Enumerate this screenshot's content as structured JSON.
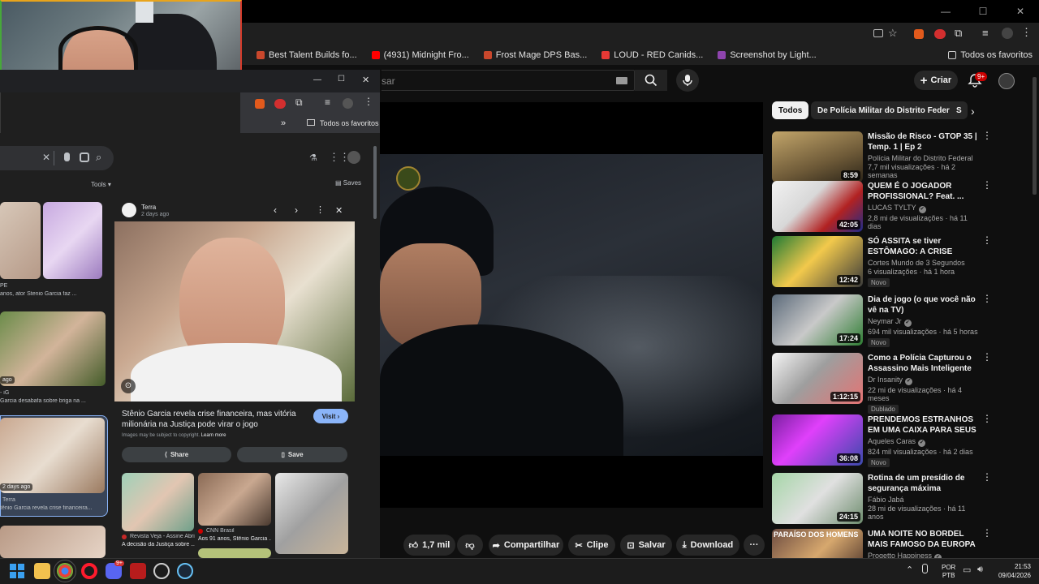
{
  "main_browser": {
    "window_controls": {
      "minimize": "—",
      "maximize": "☐",
      "close": "✕"
    },
    "bookmarks": [
      {
        "label": "Best Talent Builds fo...",
        "color": "#c9472c"
      },
      {
        "label": "(4931) Midnight Fro...",
        "color": "#ff0000"
      },
      {
        "label": "Frost Mage DPS Bas...",
        "color": "#c9472c"
      },
      {
        "label": "LOUD - RED Canids...",
        "color": "#e53935"
      },
      {
        "label": "Screenshot by Light...",
        "color": "#8e44ad"
      }
    ],
    "all_favorites": "Todos os favoritos"
  },
  "youtube": {
    "search_placeholder": "sar",
    "create_label": "Criar",
    "notif_count": "9+",
    "chips": [
      "Todos",
      "De Polícia Militar do Distrito Federal",
      "S"
    ],
    "actions": {
      "likes": "1,7 mil",
      "share": "Compartilhar",
      "clip": "Clipe",
      "save": "Salvar",
      "download": "Download"
    },
    "recommendations": [
      {
        "title": "Missão de Risco - GTOP 35 | Temp. 1 | Ep 2",
        "channel": "Polícia Militar do Distrito Federal",
        "meta": "7,7 mil visualizações · há 2 semanas",
        "duration": "8:59",
        "badge": "",
        "verified": false,
        "thumb": "linear-gradient(160deg,#c2a56a,#6e5a38 60%,#2b2418)"
      },
      {
        "title": "QUEM É O JOGADOR PROFISSIONAL? Feat. ...",
        "channel": "LUCAS TYLTY",
        "meta": "2,8 mi de visualizações · há 11 dias",
        "duration": "42:05",
        "badge": "",
        "verified": true,
        "thumb": "linear-gradient(135deg,#f2f2f2,#d8d8d8 40%,#b22222 70%,#1f2b8a)"
      },
      {
        "title": "SÓ ASSITA se tiver ESTÔMAGO: A CRISE Silenciosa Que ...",
        "channel": "Cortes Mundo de 3 Segundos",
        "meta": "6 visualizações · há 1 hora",
        "duration": "12:42",
        "badge": "Novo",
        "verified": false,
        "thumb": "linear-gradient(135deg,#1e7a34,#f2c94c 45%,#3a3a3a)"
      },
      {
        "title": "Dia de jogo (o que você não vê na TV)",
        "channel": "Neymar Jr",
        "meta": "694 mil visualizações · há 5 horas",
        "duration": "17:24",
        "badge": "Novo",
        "verified": true,
        "thumb": "linear-gradient(135deg,#5b6a7a,#c9c9c9 50%,#2e7d32)"
      },
      {
        "title": "Como a Polícia Capturou o Assassino Mais Inteligente do ...",
        "channel": "Dr Insanity",
        "meta": "22 mi de visualizações · há 4 meses",
        "duration": "1:12:15",
        "badge": "Dublado",
        "verified": true,
        "thumb": "linear-gradient(135deg,#f5f5f5,#9e9e9e 45%,#e57373)"
      },
      {
        "title": "PRENDEMOS ESTRANHOS EM UMA CAIXA PARA SEUS ...",
        "channel": "Aqueles Caras",
        "meta": "824 mil visualizações · há 2 dias",
        "duration": "36:08",
        "badge": "Novo",
        "verified": true,
        "thumb": "linear-gradient(135deg,#7b1fa2,#e040fb 40%,#3949ab)"
      },
      {
        "title": "Rotina de um presídio de segurança máxima",
        "channel": "Fábio Jabá",
        "meta": "28 mi de visualizações · há 11 anos",
        "duration": "24:15",
        "badge": "",
        "verified": false,
        "thumb": "linear-gradient(135deg,#a5d6a7,#e0e0e0 50%,#6d8c6d)"
      },
      {
        "title": "UMA NOITE NO BORDEL MAIS FAMOSO DA EUROPA",
        "channel": "Progetto Happiness",
        "meta": "",
        "duration": "",
        "badge": "",
        "verified": true,
        "thumb": "linear-gradient(135deg,#6d4c41,#d7a86e 50%,#3e2723)",
        "overlay": "PARAÍSO DOS HOMENS"
      }
    ]
  },
  "google_images": {
    "window_controls": {
      "minimize": "—",
      "maximize": "☐",
      "close": "✕"
    },
    "all_favorites": "Todos os favoritos",
    "tools": "Tools",
    "saves": "Saves",
    "results": [
      {
        "source": "PE",
        "caption": "anos, ator Stenio Garcia faz ..."
      },
      {
        "source": "- iG",
        "caption": "Garcia desabafa sobre briga na ...",
        "tag": "ago"
      },
      {
        "source": "Terra",
        "caption": "tênio Garcia revela crise financeira...",
        "tag": "2 days ago"
      }
    ],
    "panel": {
      "source": "Terra",
      "date": "2 days ago",
      "title": "Stênio Garcia revela crise financeira, mas vitória milionária na Justiça pode virar o jogo",
      "visit": "Visit",
      "copyright": "Images may be subject to copyright.",
      "learn_more": "Learn more",
      "share": "Share",
      "save": "Save",
      "related": [
        {
          "source": "Revista Veja - Assine Abril",
          "caption": "A decisão da Justiça sobre ...",
          "color": "#c62828"
        },
        {
          "source": "CNN Brasil",
          "caption": "Aos 91 anos, Stênio Garcia ...",
          "color": "#cc0000"
        },
        {
          "source": "",
          "caption": "",
          "color": "#555"
        }
      ]
    }
  },
  "taskbar": {
    "lang_top": "POR",
    "lang_bottom": "PTB",
    "time": "21:53",
    "date": "09/04/2026",
    "discord_badge": "9+"
  }
}
